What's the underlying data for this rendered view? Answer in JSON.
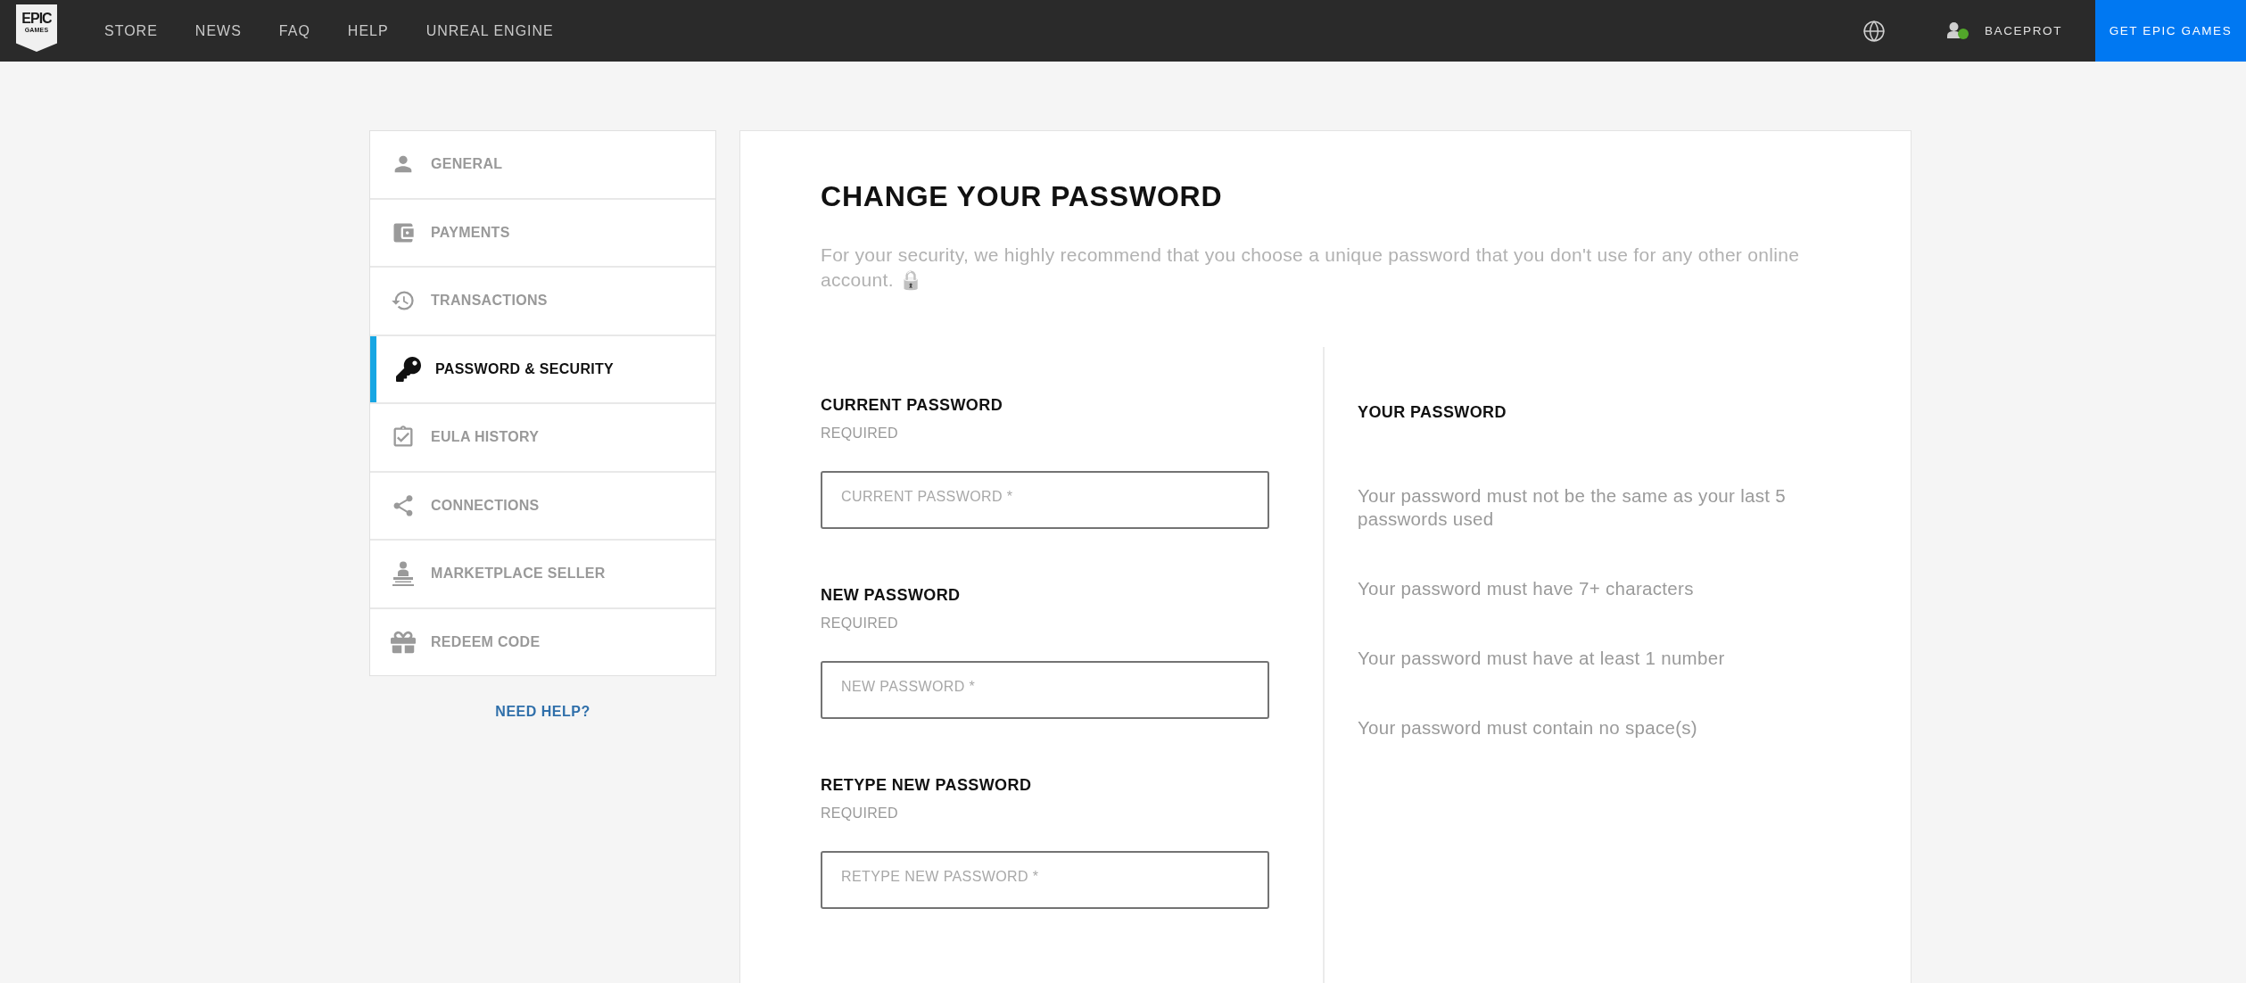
{
  "nav": {
    "logo": {
      "top": "EPIC",
      "bottom": "GAMES"
    },
    "links": [
      "STORE",
      "NEWS",
      "FAQ",
      "HELP",
      "UNREAL ENGINE"
    ],
    "user": {
      "name": "BACEPROT",
      "online": true
    },
    "cta": "GET EPIC GAMES"
  },
  "sidebar": {
    "items": [
      {
        "label": "GENERAL",
        "selected": false
      },
      {
        "label": "PAYMENTS",
        "selected": false
      },
      {
        "label": "TRANSACTIONS",
        "selected": false
      },
      {
        "label": "PASSWORD & SECURITY",
        "selected": true
      },
      {
        "label": "EULA HISTORY",
        "selected": false
      },
      {
        "label": "CONNECTIONS",
        "selected": false
      },
      {
        "label": "MARKETPLACE SELLER",
        "selected": false
      },
      {
        "label": "REDEEM CODE",
        "selected": false
      }
    ],
    "help_link": "NEED HELP?"
  },
  "main": {
    "title": "CHANGE YOUR PASSWORD",
    "description": "For your security, we highly recommend that you choose a unique password that you don't use for any other online account. 🔒",
    "fields": [
      {
        "label": "CURRENT PASSWORD",
        "note": "REQUIRED",
        "placeholder": "CURRENT PASSWORD *"
      },
      {
        "label": "NEW PASSWORD",
        "note": "REQUIRED",
        "placeholder": "NEW PASSWORD *"
      },
      {
        "label": "RETYPE NEW PASSWORD",
        "note": "REQUIRED",
        "placeholder": "RETYPE NEW PASSWORD *"
      }
    ],
    "requirements": {
      "title": "YOUR PASSWORD",
      "rules": [
        "Your password must not be the same as your last 5 passwords used",
        "Your password must have 7+ characters",
        "Your password must have at least 1 number",
        "Your password must contain no space(s)"
      ]
    }
  }
}
